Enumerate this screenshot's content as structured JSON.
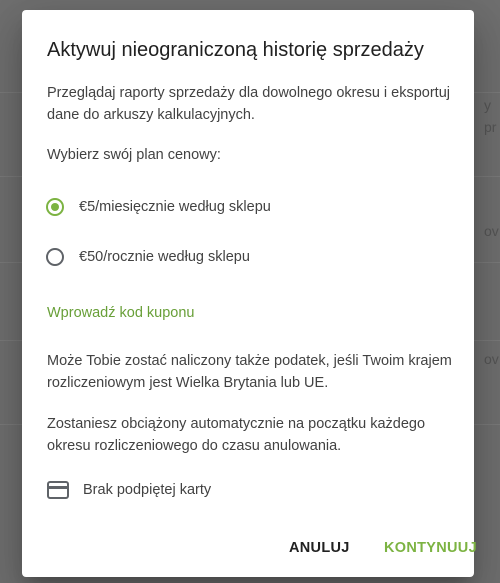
{
  "dialog": {
    "title": "Aktywuj nieograniczoną historię sprzedaży",
    "description": "Przeglądaj raporty sprzedaży dla dowolnego okresu i eksportuj dane do arkuszy kalkulacyjnych.",
    "plan_prompt": "Wybierz swój plan cenowy:",
    "plans": [
      {
        "label": "€5/miesięcznie według sklepu",
        "selected": true
      },
      {
        "label": "€50/rocznie według sklepu",
        "selected": false
      }
    ],
    "coupon_link": "Wprowadź kod kuponu",
    "tax_note": "Może Tobie zostać naliczony także podatek, jeśli Twoim krajem rozliczeniowym jest Wielka Brytania lub UE.",
    "billing_note": "Zostaniesz obciążony automatycznie na początku każdego okresu rozliczeniowego do czasu anulowania.",
    "card_status": "Brak podpiętej karty",
    "card_icon": "credit-card-icon",
    "cancel_label": "ANULUJ",
    "continue_label": "KONTYNUUJ",
    "accent_color": "#7cb342"
  },
  "background": {
    "edge_texts": [
      "y",
      "pr",
      "ov",
      "ov"
    ]
  }
}
